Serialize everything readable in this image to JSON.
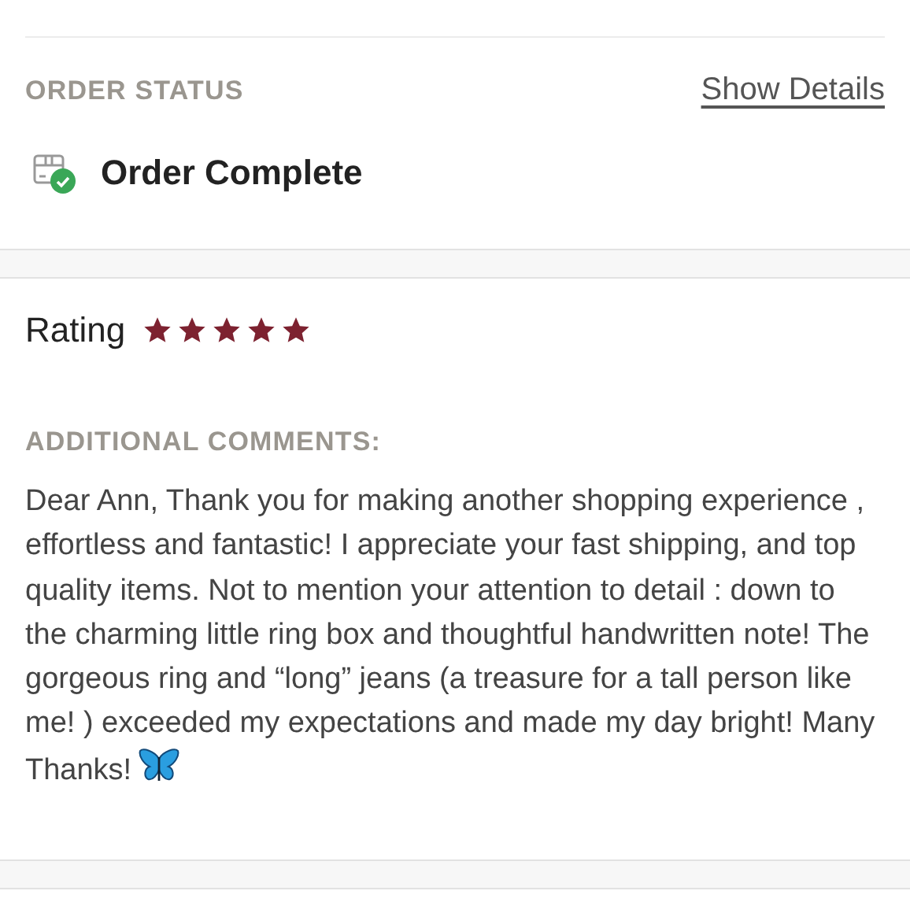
{
  "order_status": {
    "label": "ORDER STATUS",
    "link": "Show Details",
    "status": "Order Complete"
  },
  "review": {
    "label": "Rating",
    "stars": 5,
    "comments_label": "ADDITIONAL COMMENTS:",
    "comment": "Dear Ann, Thank you for making another shopping experience , effortless and fantastic! I appreciate your fast shipping, and top quality items. Not to mention your attention to detail : down to the charming little ring box and thoughtful handwritten note! The gorgeous ring and “long” jeans (a treasure for a tall person like me! ) exceeded my expectations and made my day bright! Many Thanks!"
  }
}
